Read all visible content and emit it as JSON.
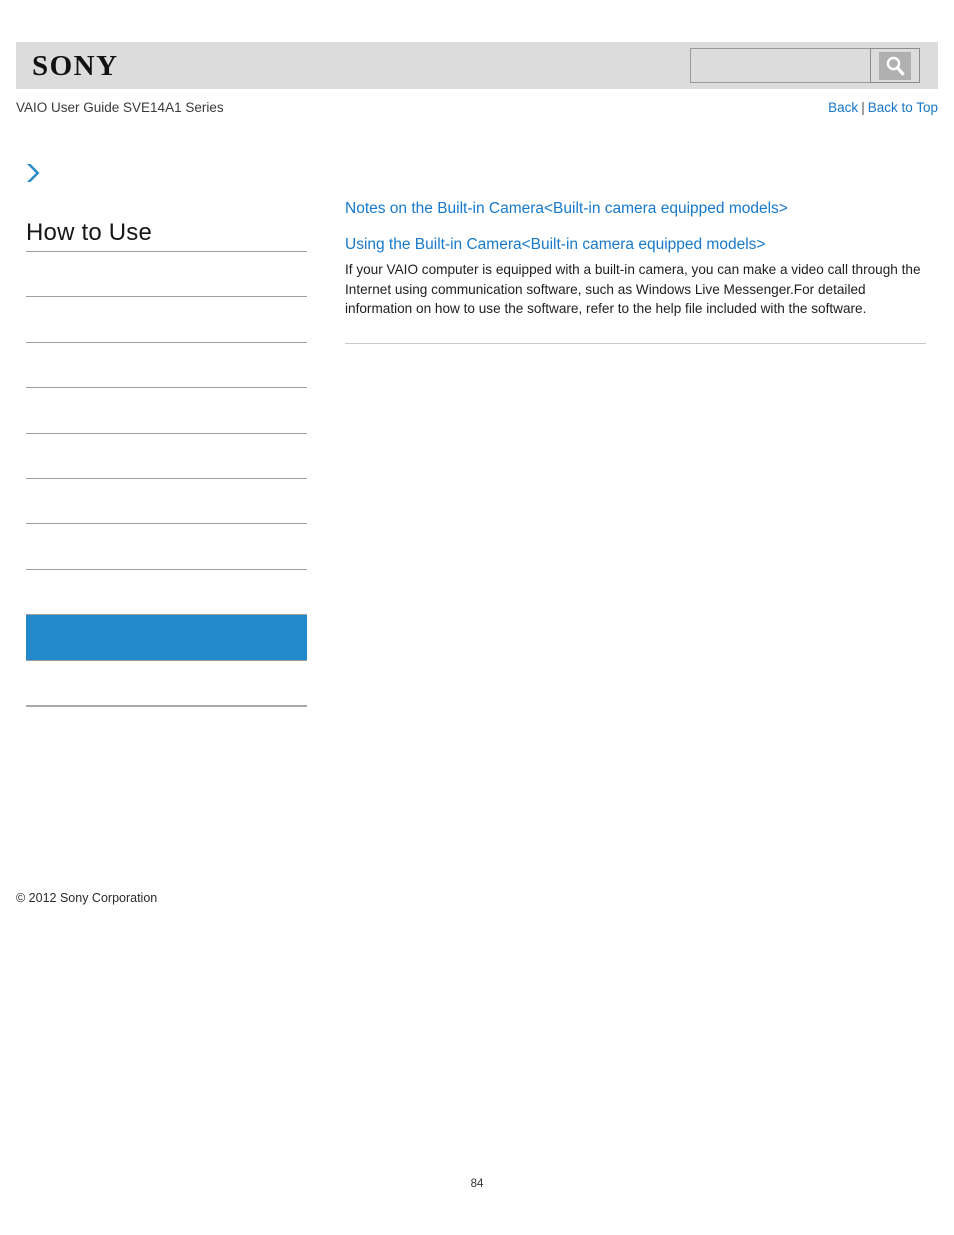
{
  "header": {
    "logo_text": "SONY",
    "search": {
      "value": "",
      "placeholder": "",
      "icon": "search-icon"
    }
  },
  "subheader": {
    "guide_title": "VAIO User Guide SVE14A1 Series",
    "links": {
      "back": "Back",
      "separator": "|",
      "back_to_top": "Back to Top"
    }
  },
  "sidebar": {
    "expand_icon": "chevron-right-icon",
    "heading": "How to Use",
    "items": [
      {
        "label": "",
        "selected": false
      },
      {
        "label": "",
        "selected": false
      },
      {
        "label": "",
        "selected": false
      },
      {
        "label": "",
        "selected": false
      },
      {
        "label": "",
        "selected": false
      },
      {
        "label": "",
        "selected": false
      },
      {
        "label": "",
        "selected": false
      },
      {
        "label": "",
        "selected": false
      },
      {
        "label": "",
        "selected": true
      },
      {
        "label": "",
        "selected": false
      }
    ],
    "copyright": "© 2012 Sony Corporation"
  },
  "content": {
    "topics": [
      {
        "link": "Notes on the Built-in Camera<Built-in camera equipped models>",
        "body": ""
      },
      {
        "link": "Using the Built-in Camera<Built-in camera equipped models>",
        "body": "If your VAIO computer is equipped with a built-in camera, you can make a video call through the Internet using communication software, such as Windows Live Messenger.For detailed information on how to use the software, refer to the help file included with the software."
      }
    ]
  },
  "footer": {
    "page_number": "84"
  },
  "colors": {
    "header_bg": "#dcdcdc",
    "link_blue": "#1779cb",
    "selected_blue": "#2289ca",
    "rule_gray": "#9e9e9e"
  }
}
